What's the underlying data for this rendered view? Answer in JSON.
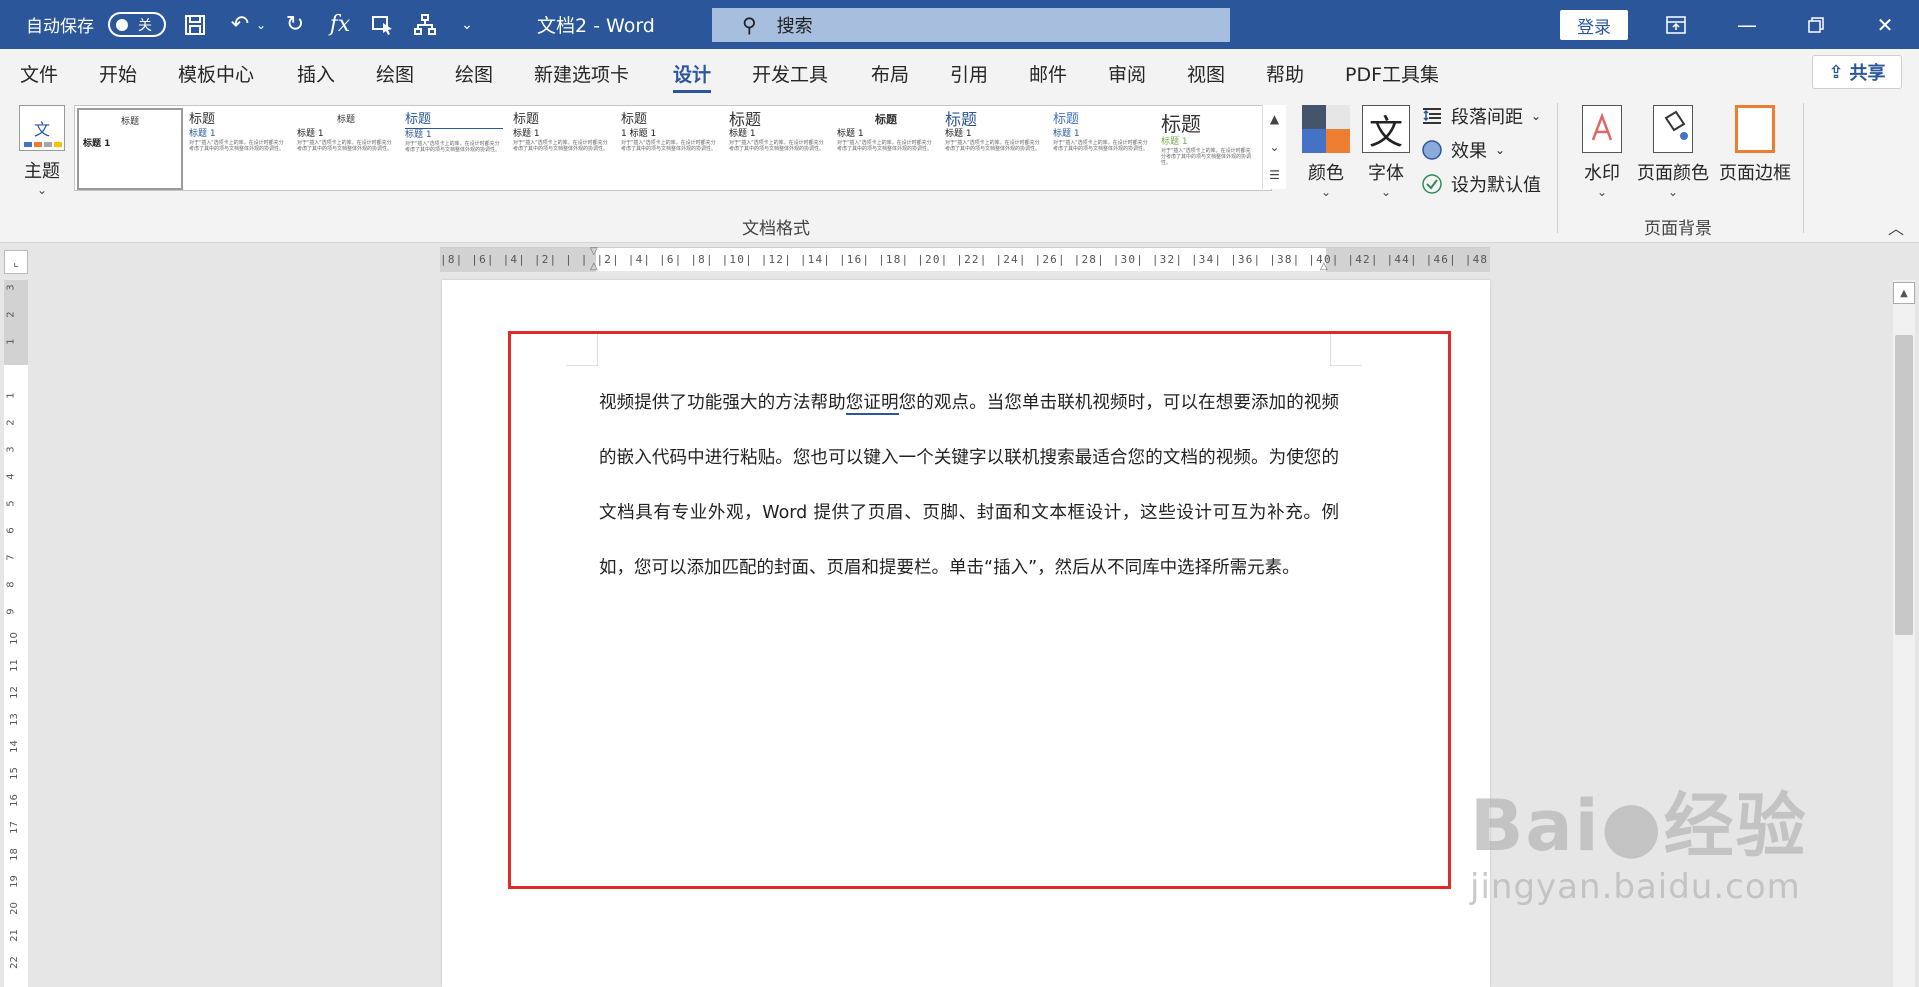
{
  "titlebar": {
    "autosave_label": "自动保存",
    "autosave_state": "关",
    "doc_title": "文档2 - Word",
    "search_placeholder": "搜索",
    "login_label": "登录",
    "quick_access_icons": [
      "save-icon",
      "undo-icon",
      "redo-icon",
      "function-icon",
      "select-icon",
      "flowchart-icon",
      "customize-icon"
    ]
  },
  "tabs": [
    "文件",
    "开始",
    "模板中心",
    "插入",
    "绘图",
    "绘图",
    "新建选项卡",
    "设计",
    "开发工具",
    "布局",
    "引用",
    "邮件",
    "审阅",
    "视图",
    "帮助",
    "PDF工具集"
  ],
  "active_tab": "设计",
  "share_label": "共享",
  "ribbon": {
    "theme_label": "主题",
    "gallery": [
      {
        "heading": "标题",
        "subheading": "标题 1",
        "body": ""
      },
      {
        "heading": "标题",
        "subheading": "标题 1",
        "body": "对于\"插入\"选项卡上的库，在设计时都充分考虑了其中的项与文档整体外观的协调性。"
      },
      {
        "heading": "标题",
        "subheading": "标题 1",
        "body": "对于\"插入\"选项卡上的库，在设计时都充分考虑了其中的项与文档整体外观的协调性。"
      },
      {
        "heading": "标题",
        "subheading": "标题 1",
        "body": "对于\"插入\"选项卡上的库，在设计时都充分考虑了其中的项与文档整体外观的协调性。"
      },
      {
        "heading": "标题",
        "subheading": "标题 1",
        "body": "对于\"插入\"选项卡上的库，在设计时都充分考虑了其中的项与文档整体外观的协调性。"
      },
      {
        "heading": "标题",
        "subheading": "1 标题 1",
        "body": "对于\"插入\"选项卡上的库，在设计时都充分考虑了其中的项与文档整体外观的协调性。"
      },
      {
        "heading": "标题",
        "subheading": "标题 1",
        "body": "对于\"插入\"选项卡上的库，在设计时都充分考虑了其中的项与文档整体外观的协调性。"
      },
      {
        "heading": "标题",
        "subheading": "标题 1",
        "body": "对于\"插入\"选项卡上的库，在设计时都充分考虑了其中的项与文档整体外观的协调性。"
      },
      {
        "heading": "标题",
        "subheading": "标题 1",
        "body": "对于\"插入\"选项卡上的库，在设计时都充分考虑了其中的项与文档整体外观的协调性。"
      },
      {
        "heading": "标题",
        "subheading": "标题 1",
        "body": "对于\"插入\"选项卡上的库，在设计时都充分考虑了其中的项与文档整体外观的协调性。"
      },
      {
        "heading": "标题",
        "subheading": "标题 1",
        "body": "对于\"插入\"选项卡上的库，在设计时都充分考虑了其中的项与文档整体外观的协调性。"
      }
    ],
    "doc_format_label": "文档格式",
    "colors_label": "颜色",
    "fonts_label": "字体",
    "font_icon_glyph": "文",
    "paragraph_spacing_label": "段落间距",
    "effects_label": "效果",
    "set_default_label": "设为默认值",
    "watermark_label": "水印",
    "page_color_label": "页面颜色",
    "page_border_label": "页面边框",
    "page_background_label": "页面背景"
  },
  "ruler": {
    "horizontal": "|8|  |6|  |4|  |2|  |   |  |2|  |4|  |6|  |8|  |10| |12| |14| |16| |18| |20| |22| |24| |26| |28| |30| |32| |34| |36| |38| |40| |42| |44| |46| |48",
    "vertical_numbers": [
      "3",
      "2",
      "1",
      "",
      "1",
      "2",
      "3",
      "4",
      "5",
      "6",
      "7",
      "8",
      "9",
      "10",
      "11",
      "12",
      "13",
      "14",
      "15",
      "16",
      "17",
      "18",
      "19",
      "20",
      "21",
      "22"
    ]
  },
  "document": {
    "text_before": "视频提供了功能强大的方法帮助",
    "text_squiggle": "您证明",
    "text_after": "您的观点。当您单击联机视频时，可以在想要添加的视频的嵌入代码中进行粘贴。您也可以键入一个关键字以联机搜索最适合您的文档的视频。为使您的文档具有专业外观，Word 提供了页眉、页脚、封面和文本框设计，这些设计可互为补充。例如，您可以添加匹配的封面、页眉和提要栏。单击“插入”，然后从不同库中选择所需元素。"
  },
  "watermark": {
    "logo": "Bai●经验",
    "url": "jingyan.baidu.com"
  },
  "colors": {
    "titlebar": "#2b579a",
    "highlight": "#e12a2a",
    "theme_swatches": [
      "#44546a",
      "#4472c4",
      "#ed7d31",
      "#a5a5a5"
    ]
  }
}
